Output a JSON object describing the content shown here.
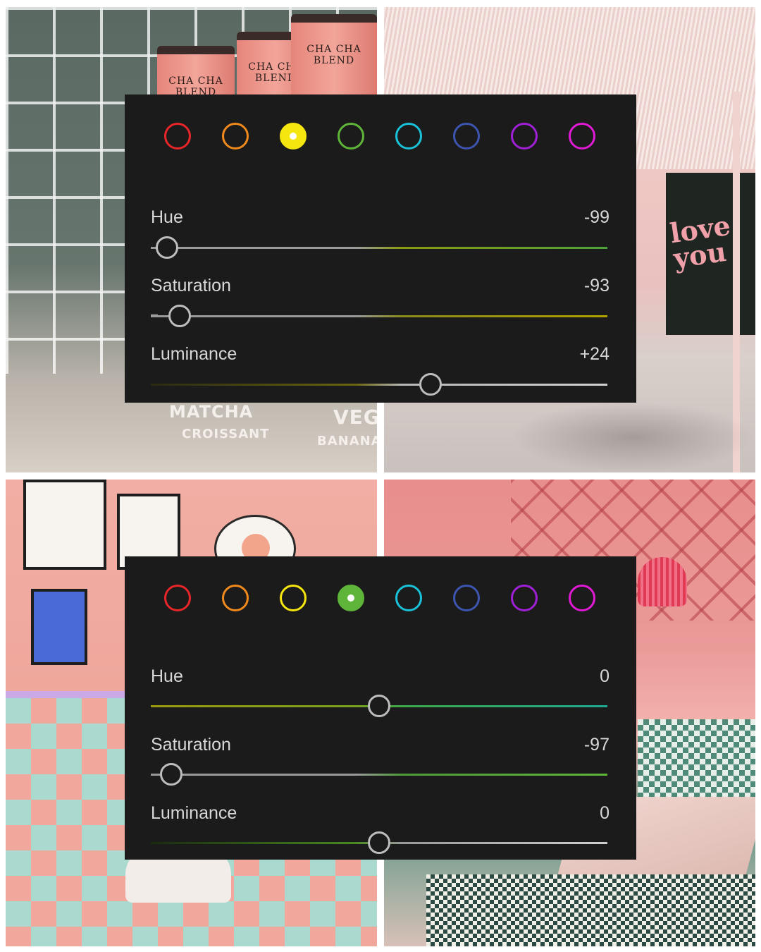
{
  "photos": {
    "top_left": {
      "can_labels": [
        "CHA CHA BLEND",
        "CHA CHA BLEND",
        "CHA CHA BLEND"
      ],
      "signs": [
        "MATCHA",
        "CROISSANT",
        "VEG",
        "BANANA"
      ]
    },
    "top_right": {
      "mural_text": "love you"
    }
  },
  "panels": [
    {
      "swatches": [
        {
          "color": "#e8262a",
          "name": "red",
          "selected": false
        },
        {
          "color": "#f08a1c",
          "name": "orange",
          "selected": false
        },
        {
          "color": "#f5e60f",
          "name": "yellow",
          "selected": true
        },
        {
          "color": "#5fb43a",
          "name": "green",
          "selected": false
        },
        {
          "color": "#19c2d8",
          "name": "aqua",
          "selected": false
        },
        {
          "color": "#3d55b0",
          "name": "blue",
          "selected": false
        },
        {
          "color": "#a020d8",
          "name": "purple",
          "selected": false
        },
        {
          "color": "#e21ad6",
          "name": "magenta",
          "selected": false
        }
      ],
      "sliders": [
        {
          "label": "Hue",
          "value": "-99",
          "level": -99,
          "gradient": [
            "#9a9a9a",
            "#9a9a9a",
            "#8a9a10",
            "#4ea23a"
          ]
        },
        {
          "label": "Saturation",
          "value": "-93",
          "level": -93,
          "gradient": [
            "#9a9a9a",
            "#9a9a9a",
            "#8a8a1a",
            "#b0a000"
          ]
        },
        {
          "label": "Luminance",
          "value": "+24",
          "level": 24,
          "gradient": [
            "#2a2a10",
            "#6a6410",
            "#b8b8b8",
            "#d0d0d0"
          ]
        }
      ]
    },
    {
      "swatches": [
        {
          "color": "#e8262a",
          "name": "red",
          "selected": false
        },
        {
          "color": "#f08a1c",
          "name": "orange",
          "selected": false
        },
        {
          "color": "#f5e60f",
          "name": "yellow",
          "selected": false
        },
        {
          "color": "#5fb43a",
          "name": "green",
          "selected": true
        },
        {
          "color": "#19c2d8",
          "name": "aqua",
          "selected": false
        },
        {
          "color": "#3d55b0",
          "name": "blue",
          "selected": false
        },
        {
          "color": "#a020d8",
          "name": "purple",
          "selected": false
        },
        {
          "color": "#e21ad6",
          "name": "magenta",
          "selected": false
        }
      ],
      "sliders": [
        {
          "label": "Hue",
          "value": "0",
          "level": 0,
          "gradient": [
            "#9a9a10",
            "#7aa020",
            "#3ca84a",
            "#20a890"
          ]
        },
        {
          "label": "Saturation",
          "value": "-97",
          "level": -97,
          "gradient": [
            "#9a9a9a",
            "#9a9a9a",
            "#4e9a3a",
            "#5fb43a"
          ]
        },
        {
          "label": "Luminance",
          "value": "0",
          "level": 0,
          "gradient": [
            "#1a2a10",
            "#4a8a20",
            "#9a9a9a",
            "#cfcfcf"
          ]
        }
      ]
    }
  ]
}
